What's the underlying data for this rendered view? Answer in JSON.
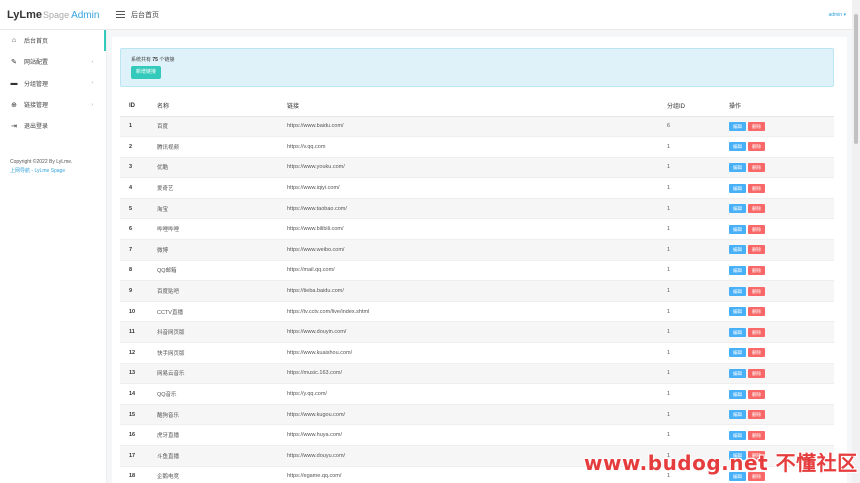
{
  "logo": {
    "part1": "LyLme",
    "part2": "Spage",
    "part3": "Admin"
  },
  "header": {
    "title": "后台首页",
    "user": "admin ▾"
  },
  "sidebar": {
    "items": [
      {
        "label": "后台首页",
        "icon": "home-icon",
        "glyph": "⌂",
        "has_arrow": false,
        "active": true
      },
      {
        "label": "网站配置",
        "icon": "palette-icon",
        "glyph": "✎",
        "has_arrow": true,
        "active": false
      },
      {
        "label": "分组管理",
        "icon": "folder-icon",
        "glyph": "▬",
        "has_arrow": true,
        "active": false
      },
      {
        "label": "链接管理",
        "icon": "globe-icon",
        "glyph": "⊕",
        "has_arrow": true,
        "active": false
      },
      {
        "label": "退出登录",
        "icon": "logout-icon",
        "glyph": "⇥",
        "has_arrow": false,
        "active": false
      }
    ],
    "arrow": "›",
    "copyright": "Copyright ©2022 By LyLme.",
    "link": "上网导航 - LyLme Spage"
  },
  "alert": {
    "prefix": "系统共有",
    "count": "75",
    "suffix": "个链接",
    "add_button": "新增链接"
  },
  "table": {
    "headers": [
      "ID",
      "名称",
      "链接",
      "分组ID",
      "操作"
    ],
    "edit_label": "编辑",
    "delete_label": "删除",
    "rows": [
      [
        "1",
        "百度",
        "https://www.baidu.com/",
        "6"
      ],
      [
        "2",
        "腾讯视频",
        "https://v.qq.com",
        "1"
      ],
      [
        "3",
        "优酷",
        "https://www.youku.com/",
        "1"
      ],
      [
        "4",
        "爱奇艺",
        "https://www.iqiyi.com/",
        "1"
      ],
      [
        "5",
        "淘宝",
        "https://www.taobao.com/",
        "1"
      ],
      [
        "6",
        "哔哩哔哩",
        "https://www.bilibili.com/",
        "1"
      ],
      [
        "7",
        "微博",
        "https://www.weibo.com/",
        "1"
      ],
      [
        "8",
        "QQ邮箱",
        "https://mail.qq.com/",
        "1"
      ],
      [
        "9",
        "百度贴吧",
        "https://tieba.baidu.com/",
        "1"
      ],
      [
        "10",
        "CCTV直播",
        "https://tv.cctv.com/live/index.shtml",
        "1"
      ],
      [
        "11",
        "抖音网页版",
        "https://www.douyin.com/",
        "1"
      ],
      [
        "12",
        "快手网页版",
        "https://www.kuaishou.com/",
        "1"
      ],
      [
        "13",
        "网易云音乐",
        "https://music.163.com/",
        "1"
      ],
      [
        "14",
        "QQ音乐",
        "https://y.qq.com/",
        "1"
      ],
      [
        "15",
        "酷狗音乐",
        "https://www.kugou.com/",
        "1"
      ],
      [
        "16",
        "虎牙直播",
        "https://www.huya.com/",
        "1"
      ],
      [
        "17",
        "斗鱼直播",
        "https://www.douyu.com/",
        "1"
      ],
      [
        "18",
        "企鹅电竞",
        "https://egame.qq.com/",
        "1"
      ]
    ]
  },
  "watermark": "www.budog.net 不懂社区",
  "colors": {
    "accent": "#33cabb",
    "link": "#33a3dc",
    "edit": "#48b0f7",
    "delete": "#f96868"
  }
}
